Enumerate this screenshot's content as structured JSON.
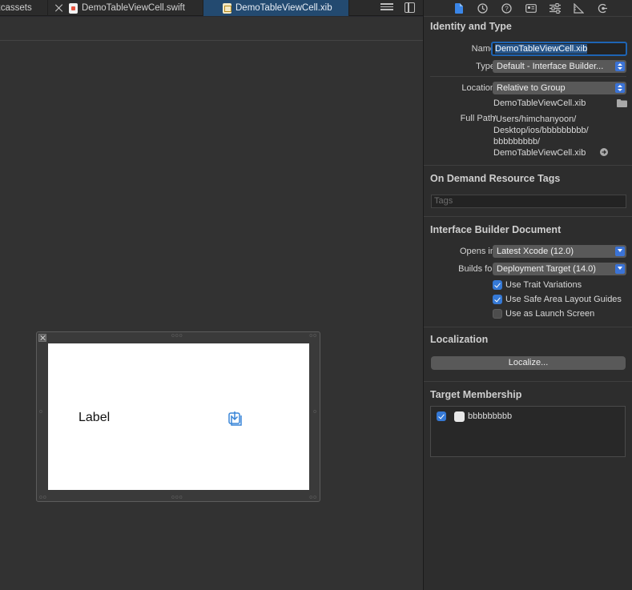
{
  "tabs": [
    {
      "label": "xcassets",
      "active": false
    },
    {
      "label": "DemoTableViewCell.swift",
      "active": false
    },
    {
      "label": "DemoTableViewCell.xib",
      "active": true
    }
  ],
  "canvas": {
    "label_text": "Label"
  },
  "inspector": {
    "identity_type": {
      "title": "Identity and Type",
      "name_label": "Name",
      "name_value": "DemoTableViewCell.xib",
      "type_label": "Type",
      "type_value": "Default - Interface Builder...",
      "location_label": "Location",
      "location_value": "Relative to Group",
      "file_name": "DemoTableViewCell.xib",
      "full_path_label": "Full Path",
      "full_path_lines": [
        "/Users/himchanyoon/",
        "Desktop/ios/bbbbbbbbb/",
        "bbbbbbbbb/",
        "DemoTableViewCell.xib"
      ]
    },
    "on_demand": {
      "title": "On Demand Resource Tags",
      "tags_placeholder": "Tags"
    },
    "ib_document": {
      "title": "Interface Builder Document",
      "opens_in_label": "Opens in",
      "opens_in_value": "Latest Xcode (12.0)",
      "builds_for_label": "Builds for",
      "builds_for_value": "Deployment Target (14.0)",
      "checkboxes": [
        {
          "label": "Use Trait Variations",
          "checked": true
        },
        {
          "label": "Use Safe Area Layout Guides",
          "checked": true
        },
        {
          "label": "Use as Launch Screen",
          "checked": false
        }
      ]
    },
    "localization": {
      "title": "Localization",
      "button_label": "Localize..."
    },
    "target_membership": {
      "title": "Target Membership",
      "targets": [
        {
          "name": "bbbbbbbbb",
          "checked": true
        }
      ]
    }
  },
  "colors": {
    "accent": "#3579d6",
    "active_tab": "#234a70",
    "inspector_bg": "#2d2d2d",
    "editor_bg": "#323232"
  }
}
